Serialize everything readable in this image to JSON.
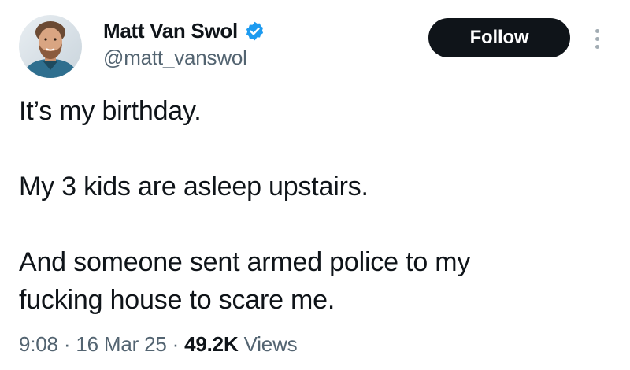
{
  "author": {
    "display_name": "Matt Van Swol",
    "handle": "@matt_vanswol",
    "verified": true,
    "avatar_icon": "profile-photo-avatar"
  },
  "actions": {
    "follow_label": "Follow",
    "more_icon": "more-dots-icon"
  },
  "tweet": {
    "lines": [
      "It’s my birthday.",
      "My 3 kids are asleep upstairs.",
      "And someone sent armed police to my",
      "fucking house to scare me."
    ]
  },
  "meta": {
    "time": "9:08",
    "separator": "·",
    "date": "16 Mar 25",
    "views_count": "49.2K",
    "views_label": "Views"
  },
  "colors": {
    "text_primary": "#0f1419",
    "text_secondary": "#536471",
    "verified_blue": "#1d9bf0",
    "follow_bg": "#0f1419"
  }
}
